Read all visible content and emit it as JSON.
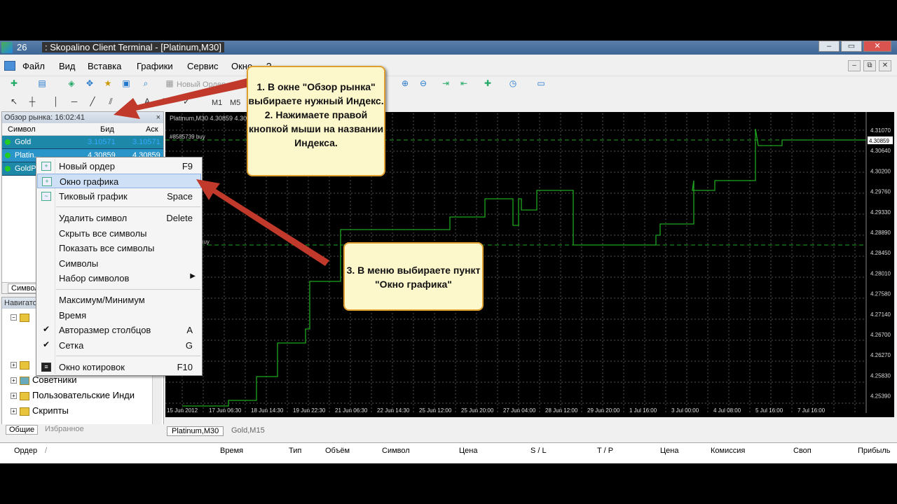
{
  "window": {
    "number": "26",
    "title": ": Skopalino Client Terminal - [Platinum,M30]"
  },
  "menu": [
    "Файл",
    "Вид",
    "Вставка",
    "Графики",
    "Сервис",
    "Окно",
    "?"
  ],
  "toolbar": {
    "new_order": "Новый Ордер",
    "timeframes": [
      "M1",
      "M5"
    ]
  },
  "market_watch": {
    "header": "Обзор рынка: 16:02:41",
    "close": "×",
    "columns": {
      "symbol": "Символ",
      "bid": "Бид",
      "ask": "Аск"
    },
    "rows": [
      {
        "symbol": "Gold",
        "bid": "3.10571",
        "ask": "3.10571"
      },
      {
        "symbol": "Platin...",
        "bid": "4.30859",
        "ask": "4.30859"
      },
      {
        "symbol": "GoldP...",
        "bid": "",
        "ask": ""
      }
    ],
    "tab": "Символ"
  },
  "navigator": {
    "header": "Навигато",
    "items": [
      "",
      "",
      "Советники",
      "Пользовательские Инди",
      "Скрипты"
    ],
    "tabs": [
      "Общие",
      "Избранное"
    ]
  },
  "chart": {
    "label": "Platinum,M30  4.30859  4.30",
    "order_label": "#8585739 buy",
    "order_label2": "buy",
    "price_marker": "4.30859",
    "y_ticks": [
      "4.31070",
      "4.30640",
      "4.30200",
      "4.29760",
      "4.29330",
      "4.28890",
      "4.28450",
      "4.28010",
      "4.27580",
      "4.27140",
      "4.26700",
      "4.26270",
      "4.25830",
      "4.25390"
    ],
    "x_ticks": [
      "15 Jun 2012",
      "17 Jun 06:30",
      "18 Jun 14:30",
      "19 Jun 22:30",
      "21 Jun 06:30",
      "22 Jun 14:30",
      "25 Jun 12:00",
      "25 Jun 20:00",
      "27 Jun 04:00",
      "28 Jun 12:00",
      "29 Jun 20:00",
      "1 Jul 16:00",
      "3 Jul 00:00",
      "4 Jul 08:00",
      "5 Jul 16:00",
      "7 Jul 16:00"
    ],
    "line_color": "#1fa51f",
    "tabs": [
      "Platinum,M30",
      "Gold,M15"
    ]
  },
  "terminal": {
    "columns": [
      "Ордер",
      "/",
      "Время",
      "Тип",
      "Объём",
      "Символ",
      "Цена",
      "S / L",
      "T / P",
      "Цена",
      "Комиссия",
      "Своп",
      "Прибыль"
    ]
  },
  "context_menu": {
    "items": [
      {
        "label": "Новый ордер",
        "key": "F9"
      },
      {
        "label": "Окно графика",
        "key": ""
      },
      {
        "label": "Тиковый график",
        "key": "Space"
      },
      {
        "label": "Удалить символ",
        "key": "Delete"
      },
      {
        "label": "Скрыть все символы",
        "key": ""
      },
      {
        "label": "Показать все символы",
        "key": ""
      },
      {
        "label": "Символы",
        "key": ""
      },
      {
        "label": "Набор символов",
        "key": ""
      },
      {
        "label": "Максимум/Минимум",
        "key": ""
      },
      {
        "label": "Время",
        "key": ""
      },
      {
        "label": "Авторазмер столбцов",
        "key": "A"
      },
      {
        "label": "Сетка",
        "key": "G"
      },
      {
        "label": "Окно котировок",
        "key": "F10"
      }
    ]
  },
  "callouts": {
    "first": "1. В окне \"Обзор рынка\" выбираете нужный Индекс.\n2. Нажимаете правой кнопкой мыши на названии Индекса.",
    "second": "3. В меню выбираете пункт \"Окно графика\""
  },
  "colors": {
    "accent": "#1e88a8",
    "callout_bg": "#fdf7cc",
    "arrow": "#c0392b"
  }
}
